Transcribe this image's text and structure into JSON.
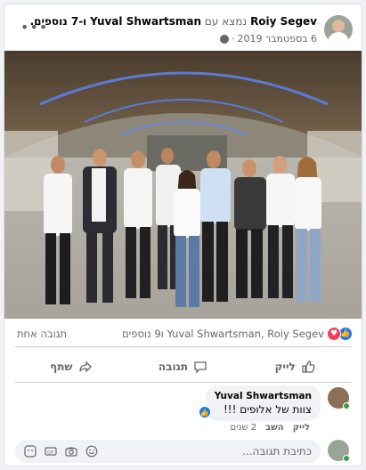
{
  "header": {
    "author": "Roiy Segev",
    "with_text": "נמצא עם",
    "tagged": "Yuval Shwartsman",
    "others": "ו-7 נוספים.",
    "date": "6 בספטמבר 2019",
    "separator": "·",
    "icons": {
      "more": "more-options-icon",
      "privacy": "globe-icon"
    }
  },
  "photo": {
    "description_icon": "group-photo"
  },
  "reactions": {
    "names": "Yuval Shwartsman, Roiy Segev ו9 נוספים",
    "comments": "תגובה אחת",
    "icons": [
      "like-reaction-icon",
      "love-reaction-icon"
    ]
  },
  "actions": {
    "like": "לייק",
    "comment": "תגובה",
    "share": "שתף"
  },
  "comment": {
    "author": "Yuval Shwartsman",
    "text": "צוות של אלופים !!!",
    "like": "לייק",
    "reply": "השב",
    "time": "2 שנים"
  },
  "composer": {
    "placeholder": "כתיבת תגובה..."
  },
  "colors": {
    "accent": "#1877f2",
    "love": "#f33e58",
    "online": "#31a24c",
    "muted": "#65676b"
  }
}
